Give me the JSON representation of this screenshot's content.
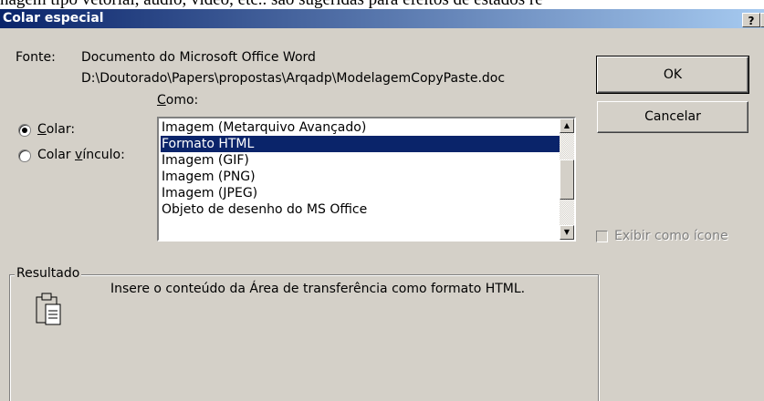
{
  "background_text": "nagem tipo vetorial, áudio, vídeo, etc.. são sugeridas para efeitos de estados re",
  "dialog": {
    "title": "Colar especial",
    "help_button": "?",
    "close_button": "✕",
    "source_label": "Fonte:",
    "source_line1": "Documento do Microsoft Office Word",
    "source_line2": "D:\\Doutorado\\Papers\\propostas\\Arqadp\\ModelagemCopyPaste.doc",
    "como_label": "Como:",
    "radio_paste": "Colar:",
    "radio_paste_link": "Colar vínculo:",
    "formats": [
      "Imagem (Metarquivo Avançado)",
      "Formato HTML",
      "Imagem (GIF)",
      "Imagem (PNG)",
      "Imagem (JPEG)",
      "Objeto de desenho do MS Office"
    ],
    "selected_format_index": 1,
    "ok_button": "OK",
    "cancel_button": "Cancelar",
    "display_as_icon": "Exibir como ícone",
    "result_label": "Resultado",
    "result_text": "Insere o conteúdo da Área de transferência como formato HTML."
  }
}
